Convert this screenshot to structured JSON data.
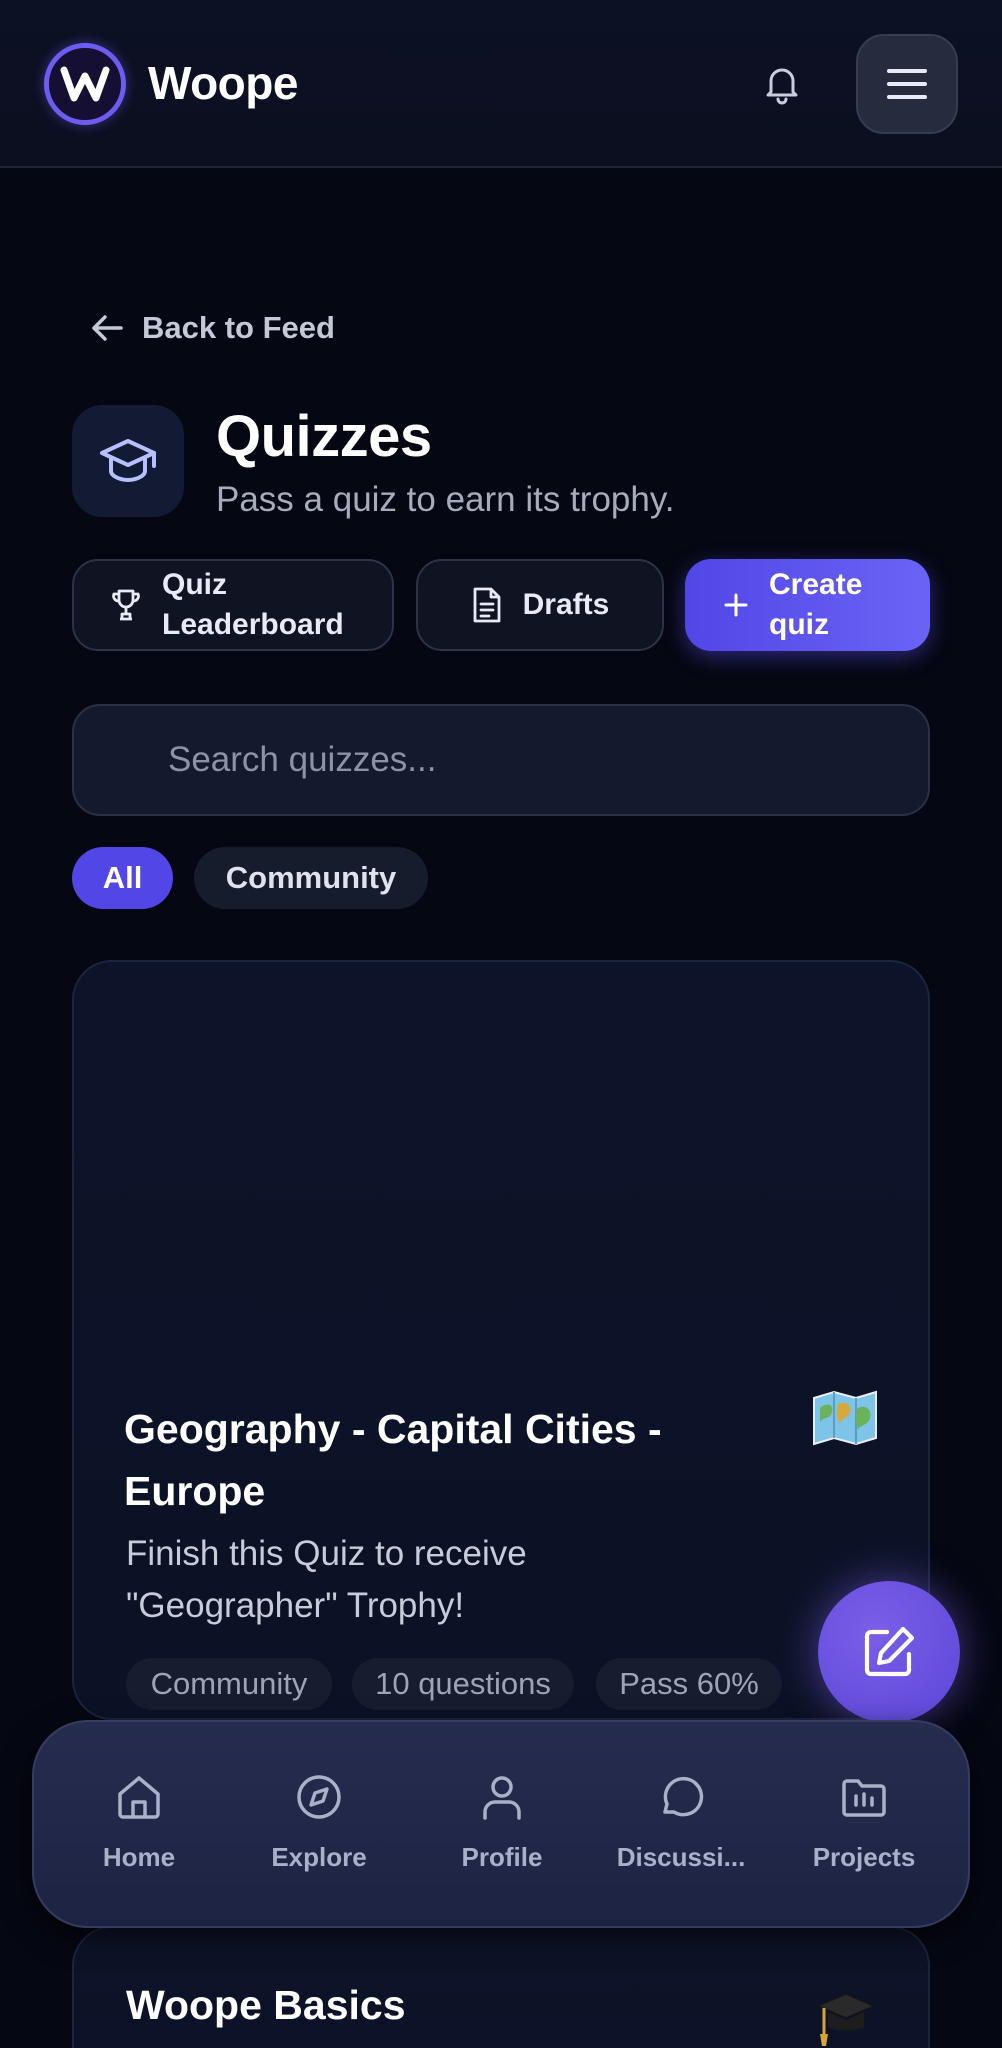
{
  "header": {
    "app_name": "Woope",
    "logo_letter": "W"
  },
  "back_link": {
    "label": "Back to Feed"
  },
  "page": {
    "title": "Quizzes",
    "subtitle": "Pass a quiz to earn its trophy."
  },
  "actions": {
    "leaderboard_line1": "Quiz",
    "leaderboard_line2": "Leaderboard",
    "drafts": "Drafts",
    "create_line1": "Create",
    "create_line2": "quiz"
  },
  "search": {
    "placeholder": "Search quizzes..."
  },
  "filters": {
    "all": "All",
    "community": "Community"
  },
  "quizzes": [
    {
      "title": "Geography - Capital Cities - Europe",
      "description": "Finish this Quiz to receive \"Geographer\" Trophy!",
      "tags": [
        "Community",
        "10 questions",
        "Pass 60%"
      ],
      "icon": "world-map-emoji"
    },
    {
      "title": "Woope Basics",
      "icon": "graduation-cap-emoji"
    }
  ],
  "bottom_nav": [
    {
      "label": "Home",
      "icon": "home-icon"
    },
    {
      "label": "Explore",
      "icon": "compass-icon"
    },
    {
      "label": "Profile",
      "icon": "user-icon"
    },
    {
      "label": "Discussi...",
      "icon": "chat-icon"
    },
    {
      "label": "Projects",
      "icon": "folder-icon"
    }
  ],
  "colors": {
    "accent": "#5246e6",
    "background": "#050712",
    "card": "#0d1328"
  }
}
